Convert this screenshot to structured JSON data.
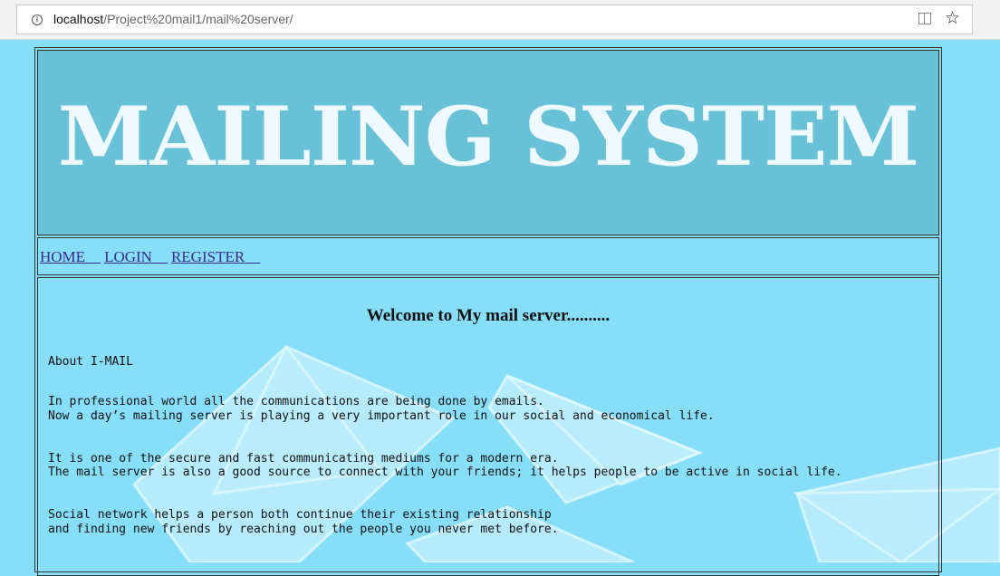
{
  "browser": {
    "url_host": "localhost",
    "url_path": "/Project%20mail1/mail%20server/"
  },
  "banner": {
    "title": "MAILING SYSTEM"
  },
  "nav": {
    "home": "HOME",
    "login": "LOGIN",
    "register": "REGISTER"
  },
  "main": {
    "welcome": "Welcome to My mail server..........",
    "about_heading": "About I-MAIL",
    "paragraphs": [
      [
        "In professional world all the communications are being done by emails.",
        "Now a day’s mailing server is playing a very important role in our social and economical life."
      ],
      [
        "It is one of the secure and fast communicating mediums for a modern era.",
        "The mail server is also a good source to connect with your friends; it helps people to be active in social life."
      ],
      [
        "Social network helps a person both continue their existing relationship",
        "and finding new friends by reaching out the people you never met before."
      ]
    ]
  },
  "colors": {
    "page_bg": "#87def9",
    "banner_bg": "#69c1d8",
    "banner_text": "#eefaff",
    "link": "#3a2a8c"
  }
}
